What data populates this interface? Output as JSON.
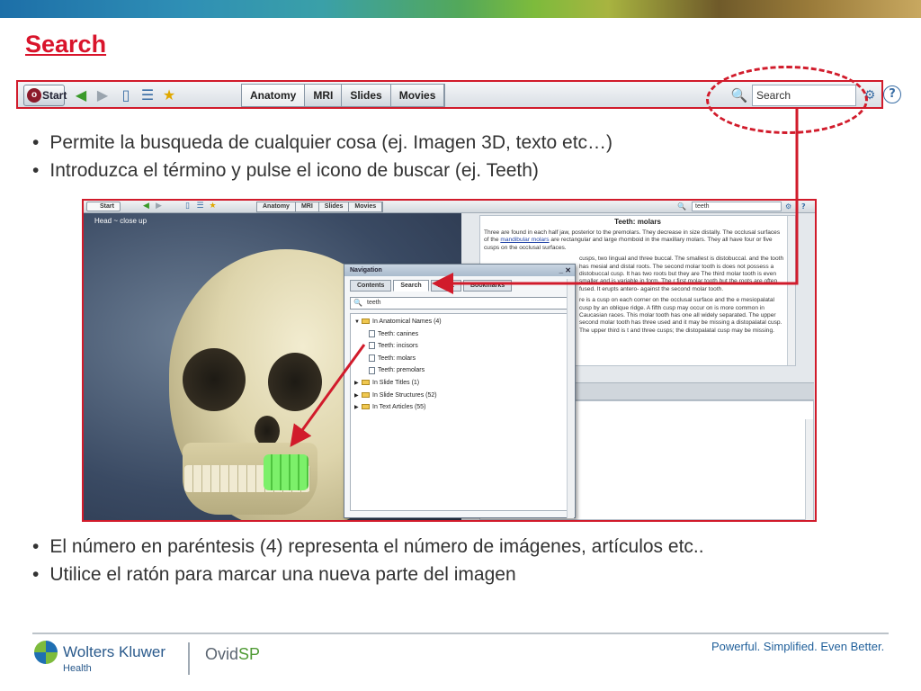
{
  "slide": {
    "title": "Search",
    "bullets_top": [
      "Permite la busqueda de cualquier cosa (ej. Imagen 3D, texto etc…)",
      "Introduzca el término y pulse el icono de buscar (ej. Teeth)"
    ],
    "bullets_bottom": [
      "El número en paréntesis (4) representa el número de imágenes, artículos etc..",
      "Utilice el ratón para marcar una nueva parte del imagen"
    ]
  },
  "toolbar": {
    "start_label": "Start",
    "tabs": [
      "Anatomy",
      "MRI",
      "Slides",
      "Movies"
    ],
    "search_value": "Search",
    "icons": [
      "back-arrow-icon",
      "forward-arrow-icon",
      "page-icon",
      "list-icon",
      "bookmark-star-icon",
      "search-icon",
      "gear-icon",
      "help-icon"
    ]
  },
  "screenshot": {
    "toolbar": {
      "start_label": "Start",
      "tabs": [
        "Anatomy",
        "MRI",
        "Slides",
        "Movies"
      ],
      "search_value": "teeth"
    },
    "viewer_title": "Head ~ close up",
    "article": {
      "title": "Teeth: molars",
      "para1_a": "Three are found in each half jaw, posterior to the premolars. They decrease in size distally. The occlusal surfaces of the ",
      "para1_link": "mandibular molars",
      "para1_b": " are rectangular and large rhomboid in the maxillary molars. They all have four or five cusps on the occlusal surfaces.",
      "para2": "cusps, two lingual and three buccal. The smallest is distobuccal. and the tooth has mesial and distal roots. The second molar tooth is does not possess a distobuccal cusp. It has two roots but they are The third molar tooth is even smaller and is variable in form. The r first molar tooth but the roots are often fused. It erupts antero- against the second molar tooth.",
      "para3": "re is a cusp on each corner on the occlusal surface and the e mesiopalatal cusp by an oblique ridge. A fifth cusp may occur on is more common in Caucasian races. This molar tooth has one all widely separated. The upper second molar tooth has three used and it may be missing a distopalatal cusp. The upper third is t and three cusps; the distopalatal cusp may be missing."
    },
    "navigation": {
      "title": "Navigation",
      "tabs": [
        "Contents",
        "Search",
        "Index",
        "Bookmarks"
      ],
      "search_value": "teeth",
      "tree": [
        {
          "label": "In Anatomical Names (4)",
          "level": 0,
          "expanded": true
        },
        {
          "label": "Teeth: canines",
          "level": 1
        },
        {
          "label": "Teeth: incisors",
          "level": 1
        },
        {
          "label": "Teeth: molars",
          "level": 1
        },
        {
          "label": "Teeth: premolars",
          "level": 1
        },
        {
          "label": "In Slide Titles (1)",
          "level": 0,
          "expanded": false
        },
        {
          "label": "In Slide Structures (52)",
          "level": 0,
          "expanded": false
        },
        {
          "label": "In Text Articles (55)",
          "level": 0,
          "expanded": false
        }
      ]
    }
  },
  "footer": {
    "brand": "Wolters Kluwer",
    "division": "Health",
    "product_a": "Ovid",
    "product_b": "SP",
    "tagline": "Powerful. Simplified. Even Better."
  },
  "colors": {
    "accent_red": "#d11b2b",
    "brand_blue": "#1f5f9a",
    "brand_green": "#4f9a34"
  }
}
